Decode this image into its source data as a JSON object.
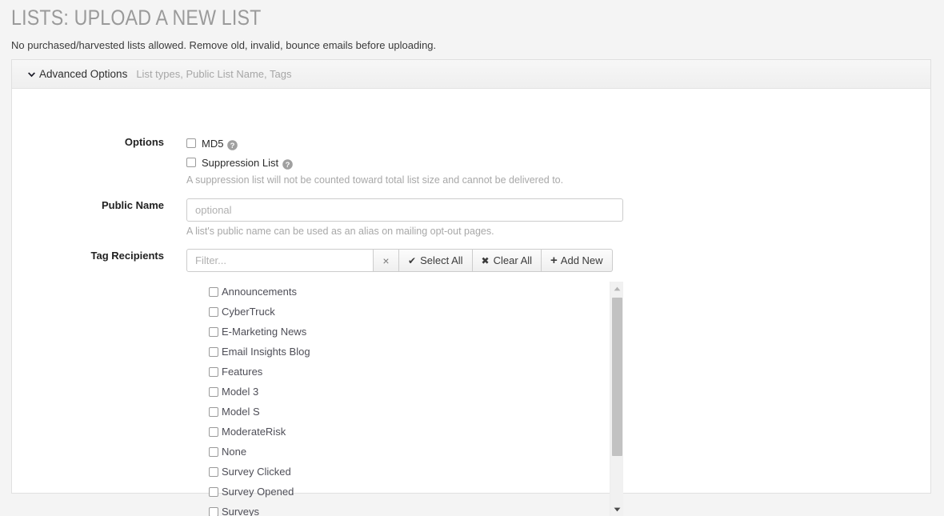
{
  "page": {
    "title": "LISTS: UPLOAD A NEW LIST",
    "subtitle": "No purchased/harvested lists allowed. Remove old, invalid, bounce emails before uploading."
  },
  "panel": {
    "header_title": "Advanced Options",
    "header_subtitle": "List types, Public List Name, Tags"
  },
  "options": {
    "label": "Options",
    "md5_label": "MD5",
    "suppression_label": "Suppression List",
    "suppression_hint": "A suppression list will not be counted toward total list size and cannot be delivered to."
  },
  "public_name": {
    "label": "Public Name",
    "value": "",
    "placeholder": "optional",
    "hint": "A list's public name can be used as an alias on mailing opt-out pages."
  },
  "tag_recipients": {
    "label": "Tag Recipients",
    "filter_value": "",
    "filter_placeholder": "Filter...",
    "clear_filter_label": "×",
    "select_all_label": "Select All",
    "clear_all_label": "Clear All",
    "add_new_label": "Add New",
    "tags": [
      "Announcements",
      "CyberTruck",
      "E-Marketing News",
      "Email Insights Blog",
      "Features",
      "Model 3",
      "Model S",
      "ModerateRisk",
      "None",
      "Survey Clicked",
      "Survey Opened",
      "Surveys"
    ]
  },
  "colors": {
    "page_bg": "#f4f4f4",
    "panel_bg": "#ffffff",
    "title_gray": "#9a9a9a",
    "hint_gray": "#a8a8a8",
    "tag_text": "#4e4e57",
    "scroll_thumb": "#c2c2c2"
  }
}
